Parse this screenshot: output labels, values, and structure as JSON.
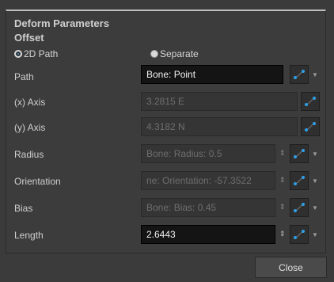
{
  "panel": {
    "title": "Deform Parameters",
    "subtitle": "Offset",
    "radio_2d": "2D Path",
    "radio_separate": "Separate"
  },
  "rows": {
    "path": {
      "label": "Path",
      "value": "Bone: Point"
    },
    "x_axis": {
      "label": "(x) Axis",
      "value": "3.2815 E"
    },
    "y_axis": {
      "label": "(y) Axis",
      "value": "4.3182 N"
    },
    "radius": {
      "label": "Radius",
      "value": "Bone: Radius: 0.5"
    },
    "orientation": {
      "label": "Orientation",
      "value": "ne: Orientation: -57.3522"
    },
    "bias": {
      "label": "Bias",
      "value": "Bone: Bias: 0.45"
    },
    "length": {
      "label": "Length",
      "value": "2.6443"
    }
  },
  "footer": {
    "close_label": "Close"
  },
  "icons": {
    "function": "function-curve-icon",
    "dropdown": "chevron-down-icon",
    "stepper": "stepper-arrows-icon"
  },
  "colors": {
    "accent_radio": "#4aa3df",
    "field_active_bg": "#141414",
    "panel_bg": "#3c3c3c"
  }
}
